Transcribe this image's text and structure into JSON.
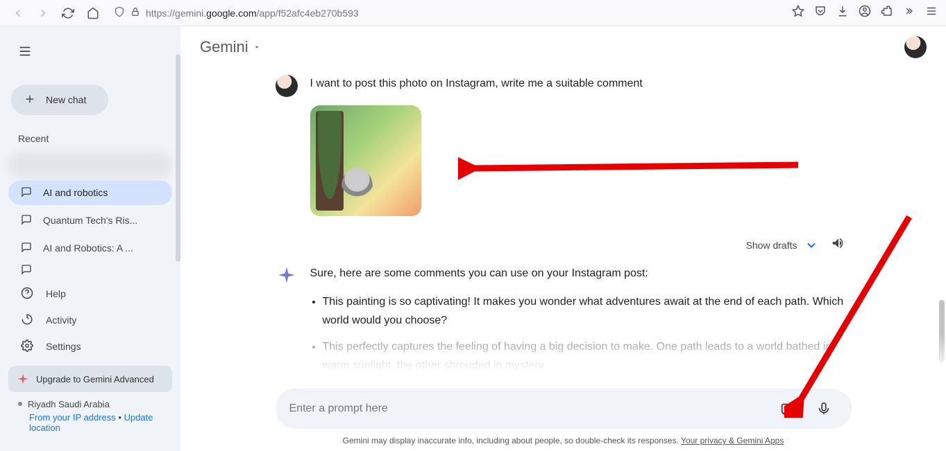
{
  "browser": {
    "url_prefix": "https://",
    "url_domain_light": "gemini.",
    "url_domain_dark": "google.com",
    "url_path": "/app/f52afc4eb270b593"
  },
  "sidebar": {
    "new_chat": "New chat",
    "recent_label": "Recent",
    "items": [
      {
        "label": ""
      },
      {
        "label": "AI and robotics"
      },
      {
        "label": "Quantum Tech's Ris..."
      },
      {
        "label": "AI and Robotics: A ..."
      }
    ],
    "help": "Help",
    "activity": "Activity",
    "settings": "Settings",
    "upgrade": "Upgrade to Gemini Advanced",
    "location_city": "Riyadh Saudi Arabia",
    "location_from": "From your IP address",
    "location_update": "Update location"
  },
  "header": {
    "app_name": "Gemini"
  },
  "conversation": {
    "user_message": "I want to post this photo on Instagram, write me a suitable comment",
    "show_drafts": "Show drafts",
    "ai_intro": "Sure, here are some comments you can use on your Instagram post:",
    "bullets": [
      "This painting is so captivating! It makes you wonder what adventures await at the end of each path. Which world would you choose?",
      "This perfectly captures the feeling of having a big decision to make. One path leads to a world bathed in warm sunlight, the other shrouded in mystery."
    ]
  },
  "input": {
    "placeholder": "Enter a prompt here"
  },
  "footer": {
    "disclaimer_text": "Gemini may display inaccurate info, including about people, so double-check its responses. ",
    "privacy_link": "Your privacy & Gemini Apps"
  }
}
